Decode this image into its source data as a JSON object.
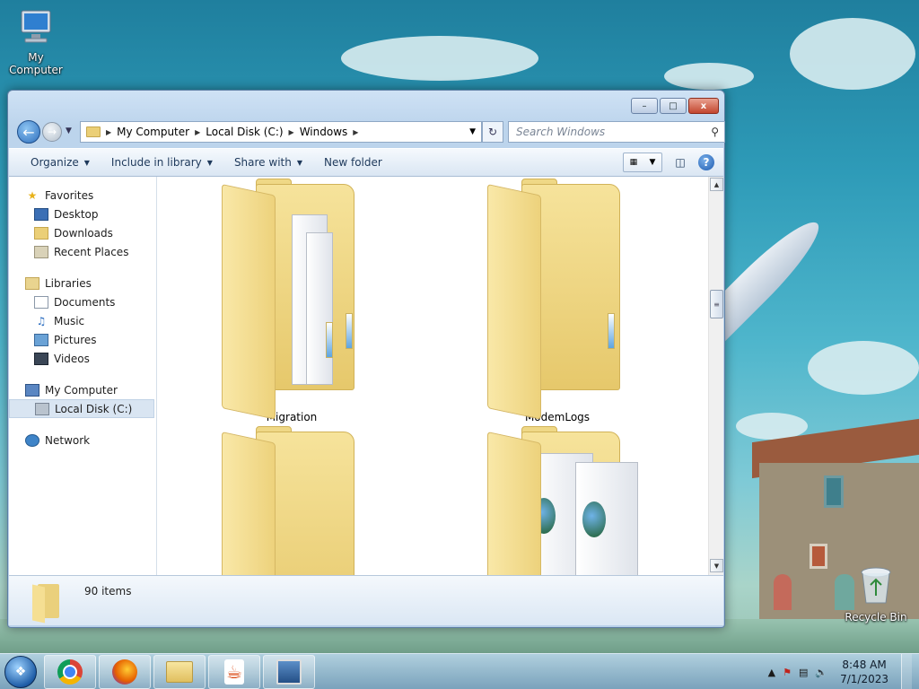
{
  "desktop": {
    "icons": [
      {
        "label": "My Computer",
        "icon": "computer-icon"
      },
      {
        "label": "Recycle Bin",
        "icon": "recycle-bin-icon"
      }
    ]
  },
  "window": {
    "controls": {
      "minimize": "–",
      "maximize": "□",
      "close": "x"
    },
    "address": {
      "segments": [
        "My Computer",
        "Local Disk (C:)",
        "Windows"
      ]
    },
    "search": {
      "placeholder": "Search Windows"
    },
    "toolbar": {
      "organize": "Organize",
      "include_in_library": "Include in library",
      "share_with": "Share with",
      "new_folder": "New folder"
    },
    "nav": {
      "favorites": {
        "label": "Favorites",
        "items": [
          "Desktop",
          "Downloads",
          "Recent Places"
        ]
      },
      "libraries": {
        "label": "Libraries",
        "items": [
          "Documents",
          "Music",
          "Pictures",
          "Videos"
        ]
      },
      "computer": {
        "label": "My Computer",
        "items": [
          "Local Disk (C:)"
        ],
        "selected": "Local Disk (C:)"
      },
      "network": {
        "label": "Network"
      }
    },
    "files": [
      {
        "name": "Migration",
        "kind": "folder-with-papers"
      },
      {
        "name": "ModemLogs",
        "kind": "folder"
      },
      {
        "name": "",
        "kind": "folder"
      },
      {
        "name": "",
        "kind": "folder-with-web-files"
      }
    ],
    "details": {
      "count": "90 items"
    }
  },
  "taskbar": {
    "apps": [
      "chrome-icon",
      "firefox-icon",
      "explorer-icon",
      "java-icon",
      "network-setup-icon"
    ],
    "tray": {
      "time": "8:48 AM",
      "date": "7/1/2023"
    }
  }
}
